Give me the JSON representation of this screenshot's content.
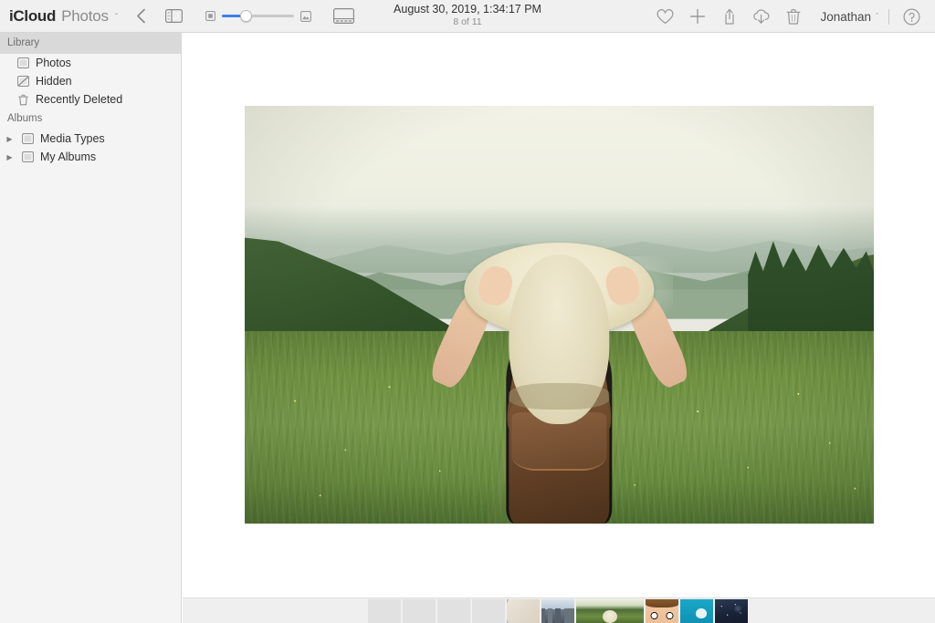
{
  "header": {
    "brand_primary": "iCloud",
    "brand_app": "Photos",
    "brand_chevron": "ˇ",
    "back_icon": "back-chevron-icon",
    "sidebar_toggle_icon": "sidebar-toggle-icon",
    "zoom_small_icon": "small-thumbnail-icon",
    "zoom_large_icon": "large-thumbnail-icon",
    "zoom_value": 30,
    "view_toggle_icon": "filmstrip-view-icon",
    "title_date": "August 30, 2019, 1:34:17 PM",
    "title_count": "8 of 11",
    "actions": [
      {
        "name": "favorite-button",
        "icon": "heart-icon"
      },
      {
        "name": "add-button",
        "icon": "plus-icon"
      },
      {
        "name": "share-button",
        "icon": "share-icon"
      },
      {
        "name": "download-button",
        "icon": "cloud-download-icon"
      },
      {
        "name": "delete-button",
        "icon": "trash-icon"
      }
    ],
    "user_name": "Jonathan",
    "user_chevron": "ˇ",
    "help_icon": "help-circle-icon",
    "accent_color": "#3f7ff0",
    "bg_color": "#f0f0f0"
  },
  "sidebar": {
    "sections": [
      {
        "title": "Library",
        "active": true,
        "items": [
          {
            "label": "Photos",
            "icon": "photo-icon"
          },
          {
            "label": "Hidden",
            "icon": "hidden-photo-icon"
          },
          {
            "label": "Recently Deleted",
            "icon": "trash-icon"
          }
        ]
      },
      {
        "title": "Albums",
        "active": false,
        "items": [
          {
            "label": "Media Types",
            "icon": "folder-icon",
            "disclosure": "▶"
          },
          {
            "label": "My Albums",
            "icon": "folder-icon",
            "disclosure": "▶"
          }
        ]
      }
    ],
    "bg_color": "#f4f4f4"
  },
  "main": {
    "photo_alt": "Woman seen from behind wearing a cream wide-brim hat and brown leather backpack standing in a green mountain meadow",
    "background_color": "#ffffff"
  },
  "filmstrip": {
    "thumbnails": [
      {
        "name": "thumb-empty-1",
        "kind": "empty",
        "selected": false
      },
      {
        "name": "thumb-empty-2",
        "kind": "empty",
        "selected": false
      },
      {
        "name": "thumb-empty-3",
        "kind": "empty",
        "selected": false
      },
      {
        "name": "thumb-empty-4",
        "kind": "empty",
        "selected": false
      },
      {
        "name": "thumb-map",
        "kind": "map",
        "selected": false
      },
      {
        "name": "thumb-city",
        "kind": "city",
        "selected": false
      },
      {
        "name": "thumb-meadow",
        "kind": "meadow",
        "selected": true
      },
      {
        "name": "thumb-face",
        "kind": "face",
        "selected": false
      },
      {
        "name": "thumb-cyan",
        "kind": "cyan",
        "selected": false
      },
      {
        "name": "thumb-night",
        "kind": "night",
        "selected": false
      }
    ],
    "bg_color": "#efefef"
  }
}
